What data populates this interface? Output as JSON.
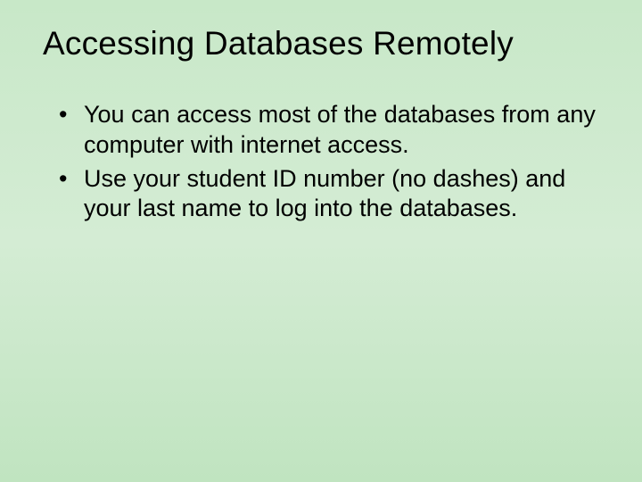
{
  "slide": {
    "title": "Accessing Databases Remotely",
    "bullets": [
      "You can access most of the databases from any computer with internet access.",
      "Use your student ID number (no dashes) and your last name to log into the databases."
    ]
  }
}
